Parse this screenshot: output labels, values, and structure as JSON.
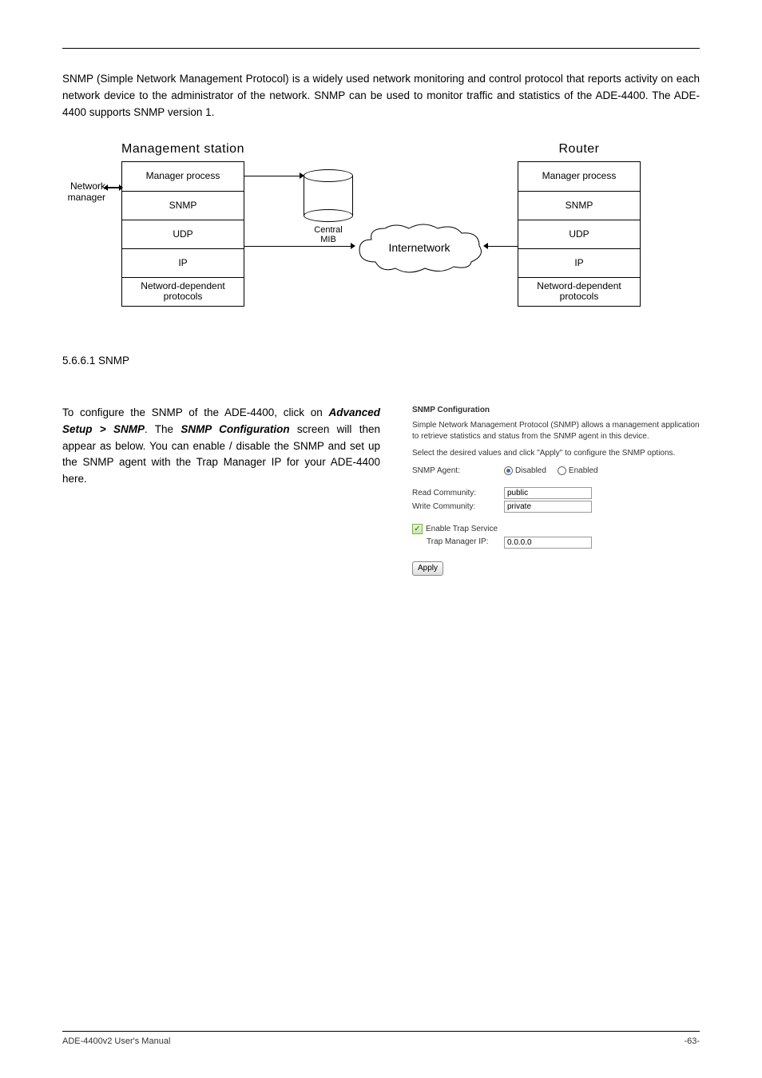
{
  "para1": "SNMP (Simple Network Management Protocol) is a widely used network monitoring and control protocol that reports activity on each network device to the administrator of the network. SNMP can be used to monitor traffic and statistics of the ADE-4400. The ADE-4400 supports SNMP version 1.",
  "diagram": {
    "left_title": "Management station",
    "right_title": "Router",
    "netmgr": "Network\nmanager",
    "cells": {
      "mgr": "Manager process",
      "snmp": "SNMP",
      "udp": "UDP",
      "ip": "IP",
      "netdep": "Netword-dependent\nprotocols"
    },
    "cyl_label": "Central\nMIB",
    "cloud_label": "Internetwork"
  },
  "h_snmp": "5.6.6.1 SNMP",
  "para2_pre": "To configure the SNMP of the ADE-4400, click on ",
  "para2_bold": "Advanced Setup > SNMP",
  "para2_post": ". The ",
  "para2_bold2": "SNMP Configuration ",
  "para2_post2": "screen will then appear as below. You can enable / disable the SNMP and set up the SNMP agent with the Trap Manager IP for your ADE-4400 here.",
  "config": {
    "title": "SNMP Configuration",
    "desc": "Simple Network Management Protocol (SNMP) allows a management application to retrieve statistics and status from the SNMP agent in this device.",
    "instr": "Select the desired values and click \"Apply\" to configure the SNMP options.",
    "agent_label": "SNMP Agent:",
    "disabled_label": "Disabled",
    "enabled_label": "Enabled",
    "read_label": "Read Community:",
    "read_value": "public",
    "write_label": "Write Community:",
    "write_value": "private",
    "trap_enable": "Enable Trap Service",
    "trap_ip_label": "Trap Manager IP:",
    "trap_ip_value": "0.0.0.0",
    "apply": "Apply"
  },
  "footer": {
    "left": "ADE-4400v2 User's Manual",
    "right": "-63-"
  }
}
